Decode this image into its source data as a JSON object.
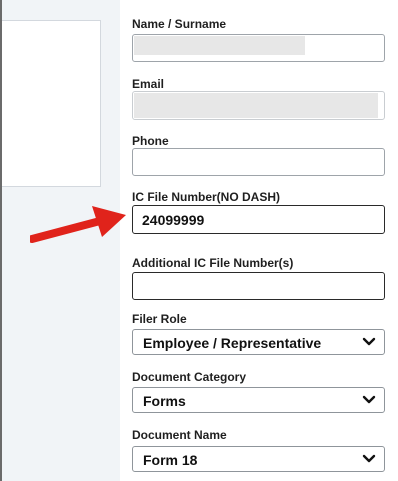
{
  "form": {
    "name": {
      "label": "Name / Surname",
      "value": ""
    },
    "email": {
      "label": "Email",
      "value": ""
    },
    "phone": {
      "label": "Phone",
      "value": ""
    },
    "ic_file": {
      "label": "IC File Number(NO DASH)",
      "value": "24099999"
    },
    "additional_ic": {
      "label": "Additional IC File Number(s)",
      "value": ""
    },
    "filer_role": {
      "label": "Filer Role",
      "value": "Employee / Representative"
    },
    "document_category": {
      "label": "Document Category",
      "value": "Forms"
    },
    "document_name": {
      "label": "Document Name",
      "value": "Form 18"
    }
  },
  "colors": {
    "arrow": "#e0231b",
    "panel": "#f1f4f7"
  },
  "icons": {
    "dropdown": "chevron-down-icon",
    "annotation": "red-arrow-icon"
  }
}
